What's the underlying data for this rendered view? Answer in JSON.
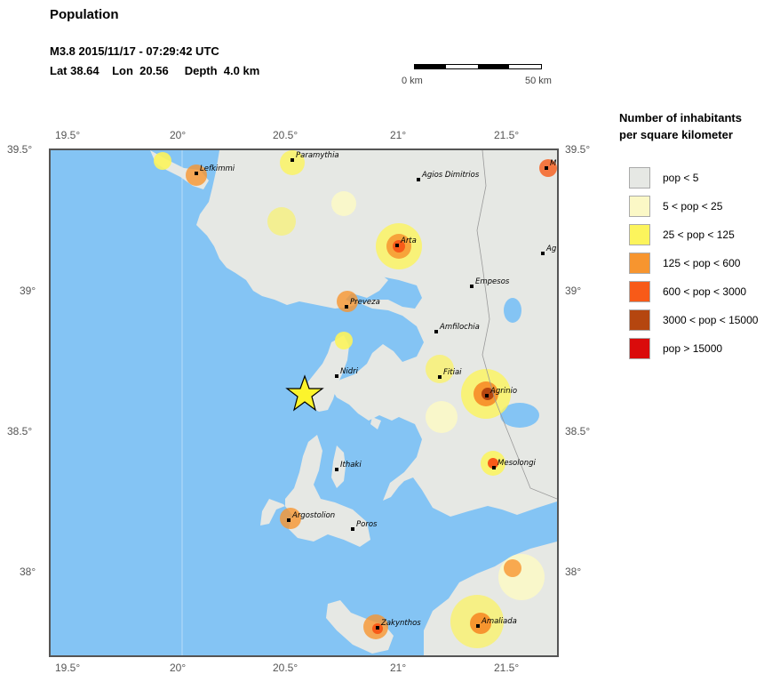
{
  "header": {
    "title": "Population",
    "event_line": "M3.8  2015/11/17 - 07:29:42 UTC",
    "location_line": "Lat 38.64    Lon  20.56     Depth  4.0 km"
  },
  "scale": {
    "left_label": "0 km",
    "right_label": "50 km"
  },
  "axes": {
    "lon_ticks": [
      "19.5°",
      "20°",
      "20.5°",
      "21°",
      "21.5°"
    ],
    "lat_ticks": [
      "39.5°",
      "39°",
      "38.5°",
      "38°"
    ]
  },
  "epicenter": {
    "lat": 38.64,
    "lon": 20.56
  },
  "cities": [
    {
      "name": "Lefkimmi"
    },
    {
      "name": "Paramythia"
    },
    {
      "name": "Agios Dimitrios"
    },
    {
      "name": "Arta"
    },
    {
      "name": "Empesos"
    },
    {
      "name": "Preveza"
    },
    {
      "name": "Amfilochia"
    },
    {
      "name": "Nidri"
    },
    {
      "name": "Fitiai"
    },
    {
      "name": "Agrinio"
    },
    {
      "name": "Ithaki"
    },
    {
      "name": "Mesolongi"
    },
    {
      "name": "Argostolion"
    },
    {
      "name": "Poros"
    },
    {
      "name": "Zakynthos"
    },
    {
      "name": "Amaliada"
    },
    {
      "name": "M"
    },
    {
      "name": "Ag"
    }
  ],
  "legend": {
    "title_line1": "Number of inhabitants",
    "title_line2": "per square kilometer",
    "items": [
      {
        "label": "pop < 5",
        "color": "#e6e8e4"
      },
      {
        "label": "5 < pop < 25",
        "color": "#fbf8c6"
      },
      {
        "label": "25 < pop < 125",
        "color": "#fcf45c"
      },
      {
        "label": "125 < pop < 600",
        "color": "#f7952f"
      },
      {
        "label": "600 < pop < 3000",
        "color": "#f85a18"
      },
      {
        "label": "3000 < pop < 15000",
        "color": "#b5460f"
      },
      {
        "label": "pop > 15000",
        "color": "#da0b0b"
      }
    ]
  },
  "colors": {
    "sea": "#84c4f4",
    "land_low": "#e6e8e4"
  }
}
